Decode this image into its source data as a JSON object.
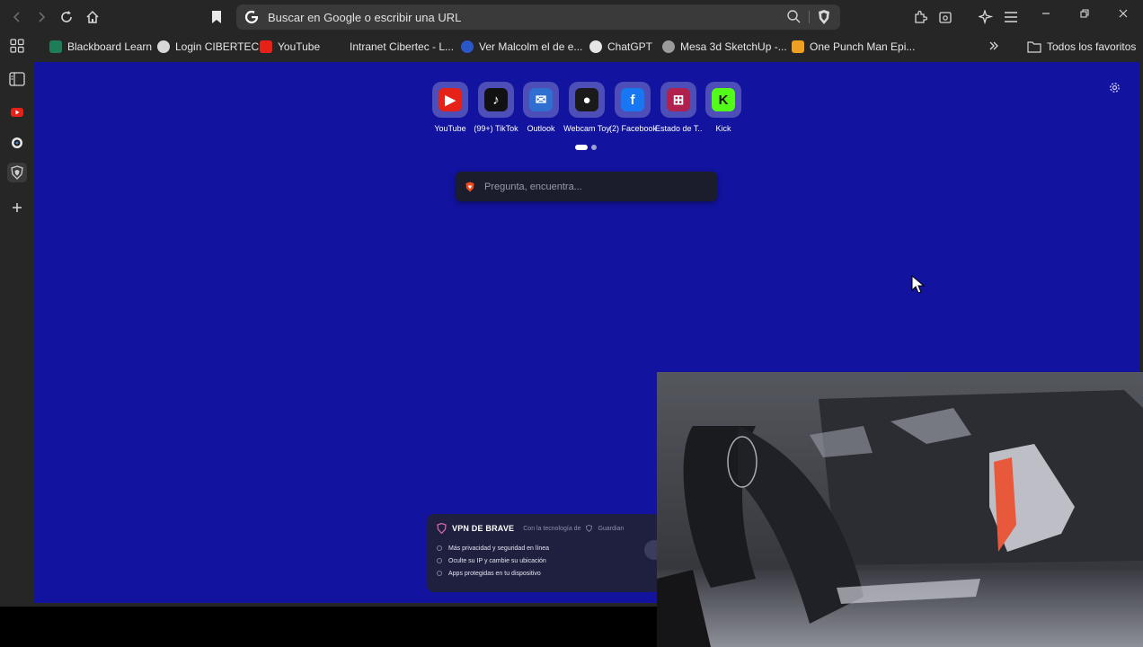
{
  "toolbar": {
    "address_placeholder": "Buscar en Google o escribir una URL",
    "address_value": ""
  },
  "bookmarks": [
    {
      "label": "Blackboard Learn",
      "color": "#1e7c56"
    },
    {
      "label": "Login CIBERTEC",
      "color": "#d8d8d8"
    },
    {
      "label": "YouTube",
      "color": "#e62117"
    },
    {
      "label": "Intranet Cibertec - L...",
      "color": "#262626"
    },
    {
      "label": "Ver Malcolm el de e...",
      "color": "#2a56c6"
    },
    {
      "label": "ChatGPT",
      "color": "#e6e6e6"
    },
    {
      "label": "Mesa 3d SketchUp -...",
      "color": "#9b9b9b"
    },
    {
      "label": "One Punch Man Epi...",
      "color": "#f0a020"
    }
  ],
  "bookmarks_all_folders": "Todos los favoritos",
  "top_sites": [
    {
      "label": "YouTube",
      "icon": "youtube-icon",
      "color": "#e62117",
      "glyph": "▶"
    },
    {
      "label": "(99+) TikTok",
      "icon": "tiktok-icon",
      "color": "#111111",
      "glyph": "♪"
    },
    {
      "label": "Outlook",
      "icon": "outlook-icon",
      "color": "#2f6fcf",
      "glyph": "✉"
    },
    {
      "label": "Webcam Toy",
      "icon": "webcam-toy-icon",
      "color": "#1a1a1a",
      "glyph": "●"
    },
    {
      "label": "(2) Facebook",
      "icon": "facebook-icon",
      "color": "#1877f2",
      "glyph": "f"
    },
    {
      "label": "Estado de T...",
      "icon": "estado-icon",
      "color": "#b0224d",
      "glyph": "⊞"
    },
    {
      "label": "Kick",
      "icon": "kick-icon",
      "color": "#53fc18",
      "glyph": "K"
    }
  ],
  "search_placeholder": "Pregunta, encuentra...",
  "vpn": {
    "title": "VPN DE BRAVE",
    "powered_by": "Con la tecnología de",
    "powered_brand": "Guardian",
    "features": [
      "Más privacidad y seguridad en línea",
      "Oculte su IP y cambie su ubicación",
      "Apps protegidas en tu dispositivo"
    ]
  }
}
